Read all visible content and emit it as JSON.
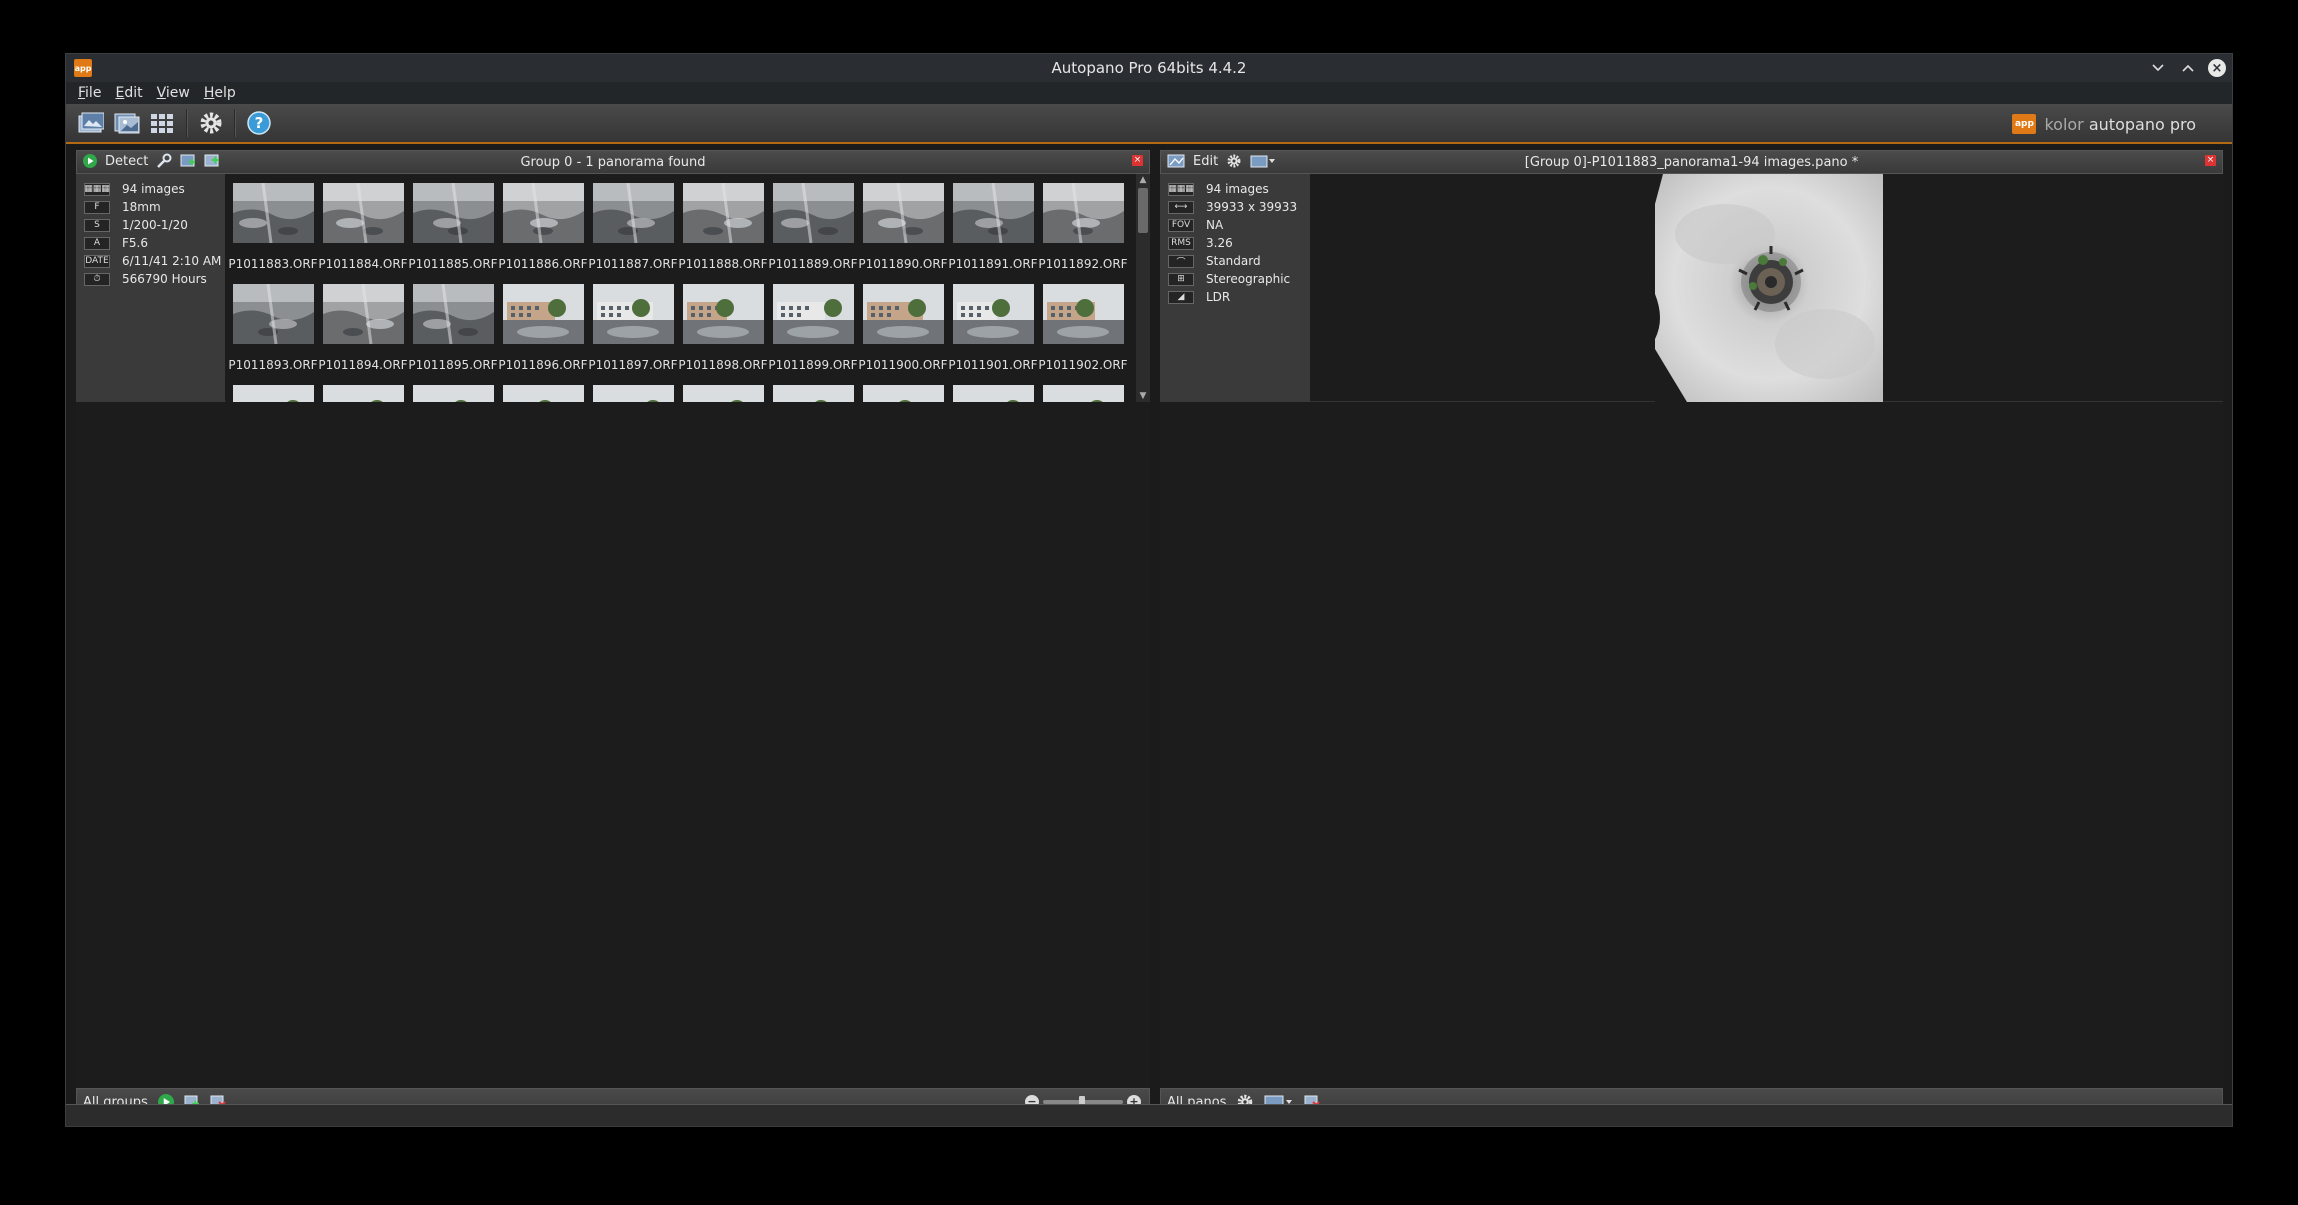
{
  "window": {
    "title": "Autopano Pro 64bits 4.4.2",
    "app_icon": "app-icon",
    "close_glyph": "×"
  },
  "menu": [
    "File",
    "Edit",
    "View",
    "Help"
  ],
  "brand": {
    "logo": "app",
    "kolor": "kolor",
    "product": "autopano pro"
  },
  "left_panel": {
    "detect_label": "Detect",
    "title": "Group 0 - 1 panorama found",
    "close_glyph": "×",
    "info": [
      {
        "icon": "grid-icon",
        "badge": "▦▦▦",
        "value": "94 images"
      },
      {
        "icon": "focal-icon",
        "badge": "F",
        "value": "18mm"
      },
      {
        "icon": "shutter-icon",
        "badge": "S",
        "value": "1/200-1/20"
      },
      {
        "icon": "aperture-icon",
        "badge": "A",
        "value": "F5.6"
      },
      {
        "icon": "date-icon",
        "badge": "DATE",
        "value": "6/11/41 2:10 AM"
      },
      {
        "icon": "clock-icon",
        "badge": "⏱",
        "value": "566790 Hours"
      }
    ],
    "thumbnails": [
      "P1011883.ORF",
      "P1011884.ORF",
      "P1011885.ORF",
      "P1011886.ORF",
      "P1011887.ORF",
      "P1011888.ORF",
      "P1011889.ORF",
      "P1011890.ORF",
      "P1011891.ORF",
      "P1011892.ORF",
      "P1011893.ORF",
      "P1011894.ORF",
      "P1011895.ORF",
      "P1011896.ORF",
      "P1011897.ORF",
      "P1011898.ORF",
      "P1011899.ORF",
      "P1011900.ORF",
      "P1011901.ORF",
      "P1011902.ORF"
    ],
    "footer_label": "All groups"
  },
  "right_panel": {
    "edit_label": "Edit",
    "title": "[Group 0]-P1011883_panorama1-94 images.pano *",
    "close_glyph": "×",
    "info": [
      {
        "icon": "grid-icon",
        "badge": "▦▦▦",
        "value": "94 images"
      },
      {
        "icon": "size-icon",
        "badge": "⟷",
        "value": "39933 x 39933"
      },
      {
        "icon": "fov-icon",
        "badge": "FOV",
        "value": "NA"
      },
      {
        "icon": "rms-icon",
        "badge": "RMS",
        "value": "3.26"
      },
      {
        "icon": "lens-icon",
        "badge": "⌒",
        "value": "Standard"
      },
      {
        "icon": "projection-icon",
        "badge": "⊞",
        "value": "Stereographic"
      },
      {
        "icon": "ldr-icon",
        "badge": "◢",
        "value": "LDR"
      }
    ],
    "footer_label": "All panos"
  },
  "colors": {
    "accent": "#b36a12",
    "brand": "#e07a16",
    "panel": "#3a3a3a"
  }
}
